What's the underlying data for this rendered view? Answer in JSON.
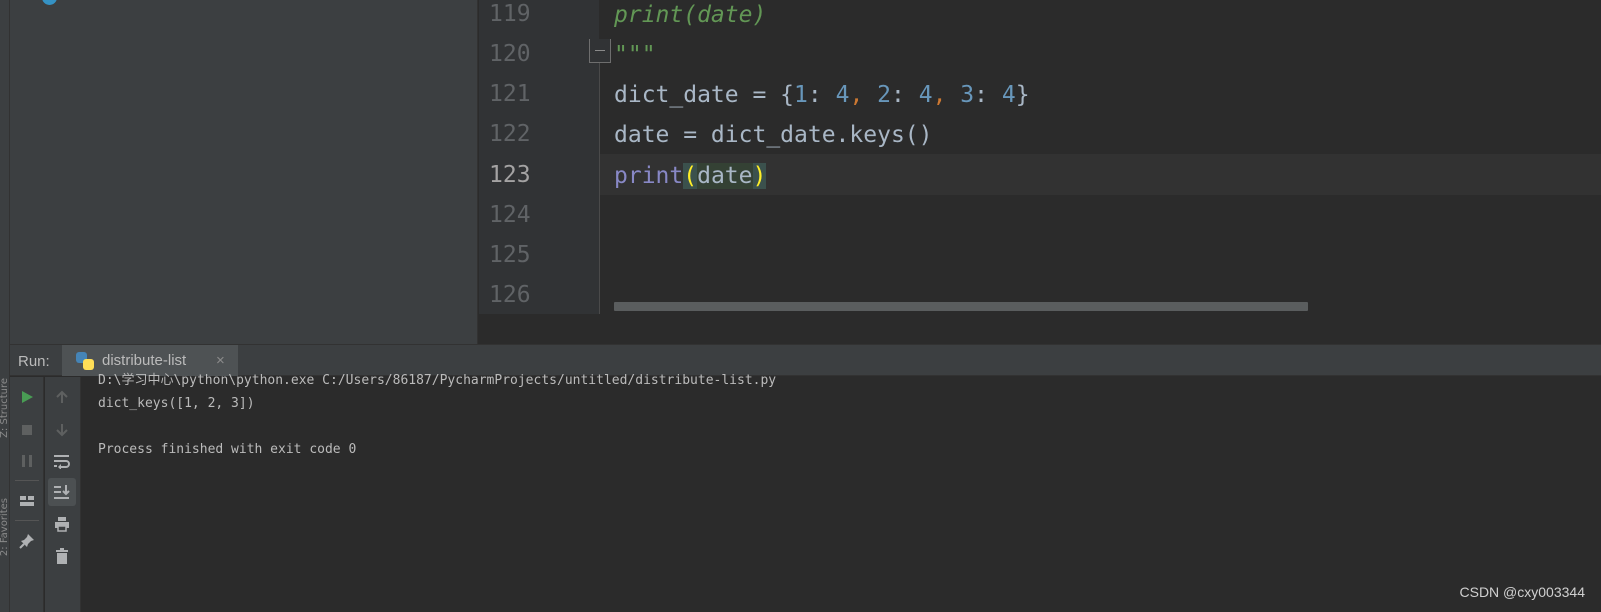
{
  "side_strip": {
    "structure_label": "Z: Structure",
    "favorites_label": "2: Favorites"
  },
  "editor": {
    "line_numbers": [
      "119",
      "120",
      "121",
      "122",
      "123",
      "124",
      "125",
      "126"
    ],
    "active_line": "123",
    "code": {
      "l119": "print(date)",
      "l120": "\"\"\"",
      "l121": {
        "var": "dict_date = ",
        "open": "{",
        "k1": "1",
        "c1": ": ",
        "v1": "4",
        "s1": ", ",
        "k2": "2",
        "c2": ": ",
        "v2": "4",
        "s2": ", ",
        "k3": "3",
        "c3": ": ",
        "v3": "4",
        "close": "}"
      },
      "l122": "date = dict_date.keys()",
      "l123": {
        "fn": "print",
        "open": "(",
        "arg": "date",
        "close": ")"
      }
    }
  },
  "run": {
    "label": "Run:",
    "tab_label": "distribute-list",
    "close_glyph": "×",
    "console_lines": [
      "D:\\学习中心\\python\\python.exe C:/Users/86187/PycharmProjects/untitled/distribute-list.py",
      "dict_keys([1, 2, 3])",
      "",
      "Process finished with exit code 0"
    ]
  },
  "icons": {
    "run": "play-icon",
    "stop": "stop-icon",
    "pause": "pause-icon",
    "layout": "layout-icon",
    "pin": "pin-icon",
    "up": "arrow-up-icon",
    "down": "arrow-down-icon",
    "wrap": "soft-wrap-icon",
    "scroll_end": "scroll-to-end-icon",
    "print": "print-icon",
    "trash": "trash-icon"
  },
  "colors": {
    "run_green": "#499c54",
    "keyword_builtin": "#8888c6",
    "number": "#6897bb",
    "docstring": "#629755",
    "punctuation": "#cc7832",
    "brace_match": "#ffef28"
  },
  "watermark": "CSDN @cxy003344"
}
